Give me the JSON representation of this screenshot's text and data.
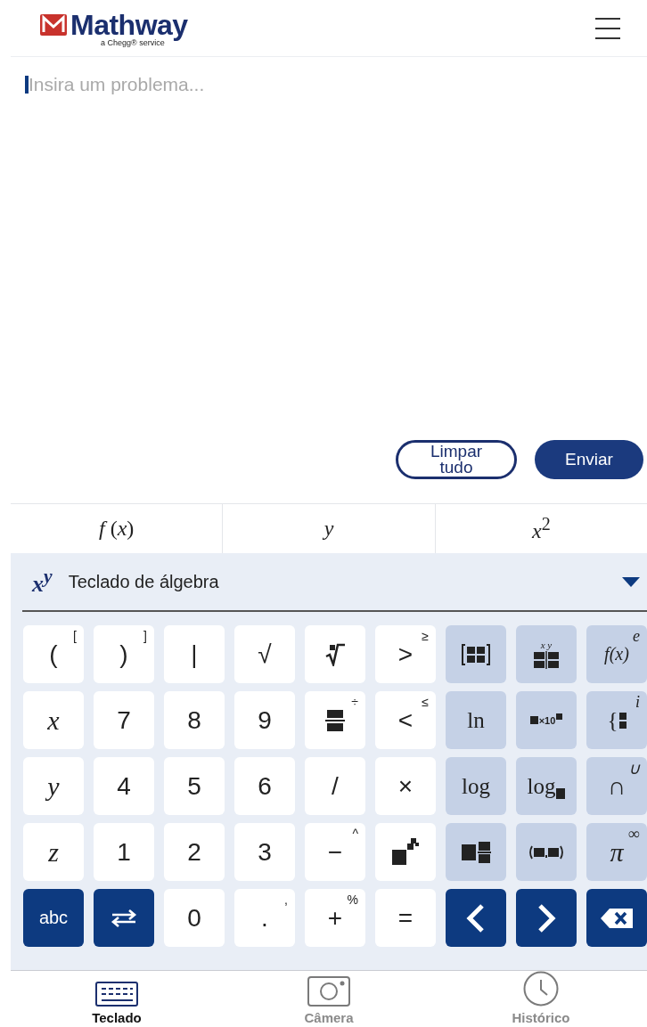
{
  "header": {
    "logo": "Mathway",
    "tagline": "a Chegg® service"
  },
  "editor": {
    "placeholder": "Insira um problema..."
  },
  "actions": [
    {
      "label": "Limpar tudo",
      "kind": "outline"
    },
    {
      "label": "Enviar",
      "kind": "filled"
    }
  ],
  "tabs": [
    {
      "label": "*f* (*x*)"
    },
    {
      "label": "*y*"
    },
    {
      "label": "*x*$^{2}$"
    }
  ],
  "keyboard_select": {
    "symbol": "x$^{y}$",
    "label": "Teclado de álgebra"
  },
  "keys": [
    [
      {
        "label": "(",
        "corner": "[",
        "kind": "text"
      },
      {
        "label": ")",
        "corner": "]",
        "kind": "text"
      },
      {
        "label": "|",
        "kind": "text"
      },
      {
        "label": "√",
        "kind": "text"
      },
      {
        "kind": "nthroot"
      },
      {
        "label": ">",
        "corner": "≥",
        "kind": "text"
      },
      {
        "kind": "matrix"
      },
      {
        "label": "x y",
        "kind": "table"
      },
      {
        "label": "f(x)",
        "corner": "e",
        "kind": "math"
      }
    ],
    [
      {
        "label": "x",
        "kind": "math"
      },
      {
        "label": "7",
        "kind": "text"
      },
      {
        "label": "8",
        "kind": "text"
      },
      {
        "label": "9",
        "kind": "text"
      },
      {
        "corner": "÷",
        "kind": "fraction"
      },
      {
        "label": "<",
        "corner": "≤",
        "kind": "text"
      },
      {
        "label": "ln",
        "kind": "func"
      },
      {
        "label": "×10",
        "kind": "scinot"
      },
      {
        "label": "{",
        "corner": "i",
        "kind": "piecewise"
      }
    ],
    [
      {
        "label": "y",
        "kind": "math"
      },
      {
        "label": "4",
        "kind": "text"
      },
      {
        "label": "5",
        "kind": "text"
      },
      {
        "label": "6",
        "kind": "text"
      },
      {
        "label": "/",
        "kind": "text"
      },
      {
        "label": "×",
        "kind": "text"
      },
      {
        "label": "log",
        "kind": "func"
      },
      {
        "label": "log",
        "kind": "logbase"
      },
      {
        "label": "∩",
        "corner": "∪",
        "kind": "text"
      }
    ],
    [
      {
        "label": "z",
        "kind": "math"
      },
      {
        "label": "1",
        "kind": "text"
      },
      {
        "label": "2",
        "kind": "text"
      },
      {
        "label": "3",
        "kind": "text"
      },
      {
        "label": "−",
        "corner": "^",
        "kind": "text"
      },
      {
        "kind": "power"
      },
      {
        "kind": "mixed"
      },
      {
        "kind": "pair"
      },
      {
        "label": "π",
        "corner": "∞",
        "kind": "math"
      }
    ],
    [
      {
        "label": "abc",
        "kind": "text"
      },
      {
        "kind": "swap"
      },
      {
        "label": "0",
        "kind": "text"
      },
      {
        "label": ".",
        "corner": ",",
        "kind": "text"
      },
      {
        "label": "+",
        "corner": "%",
        "kind": "text"
      },
      {
        "label": "=",
        "kind": "text"
      },
      {
        "kind": "left"
      },
      {
        "kind": "right"
      },
      {
        "kind": "backspace"
      }
    ]
  ],
  "nav": [
    {
      "label": "Teclado",
      "kind": "keyboard",
      "selected": true
    },
    {
      "label": "Câmera",
      "kind": "camera",
      "selected": false
    },
    {
      "label": "Histórico",
      "kind": "clock",
      "selected": false
    }
  ]
}
